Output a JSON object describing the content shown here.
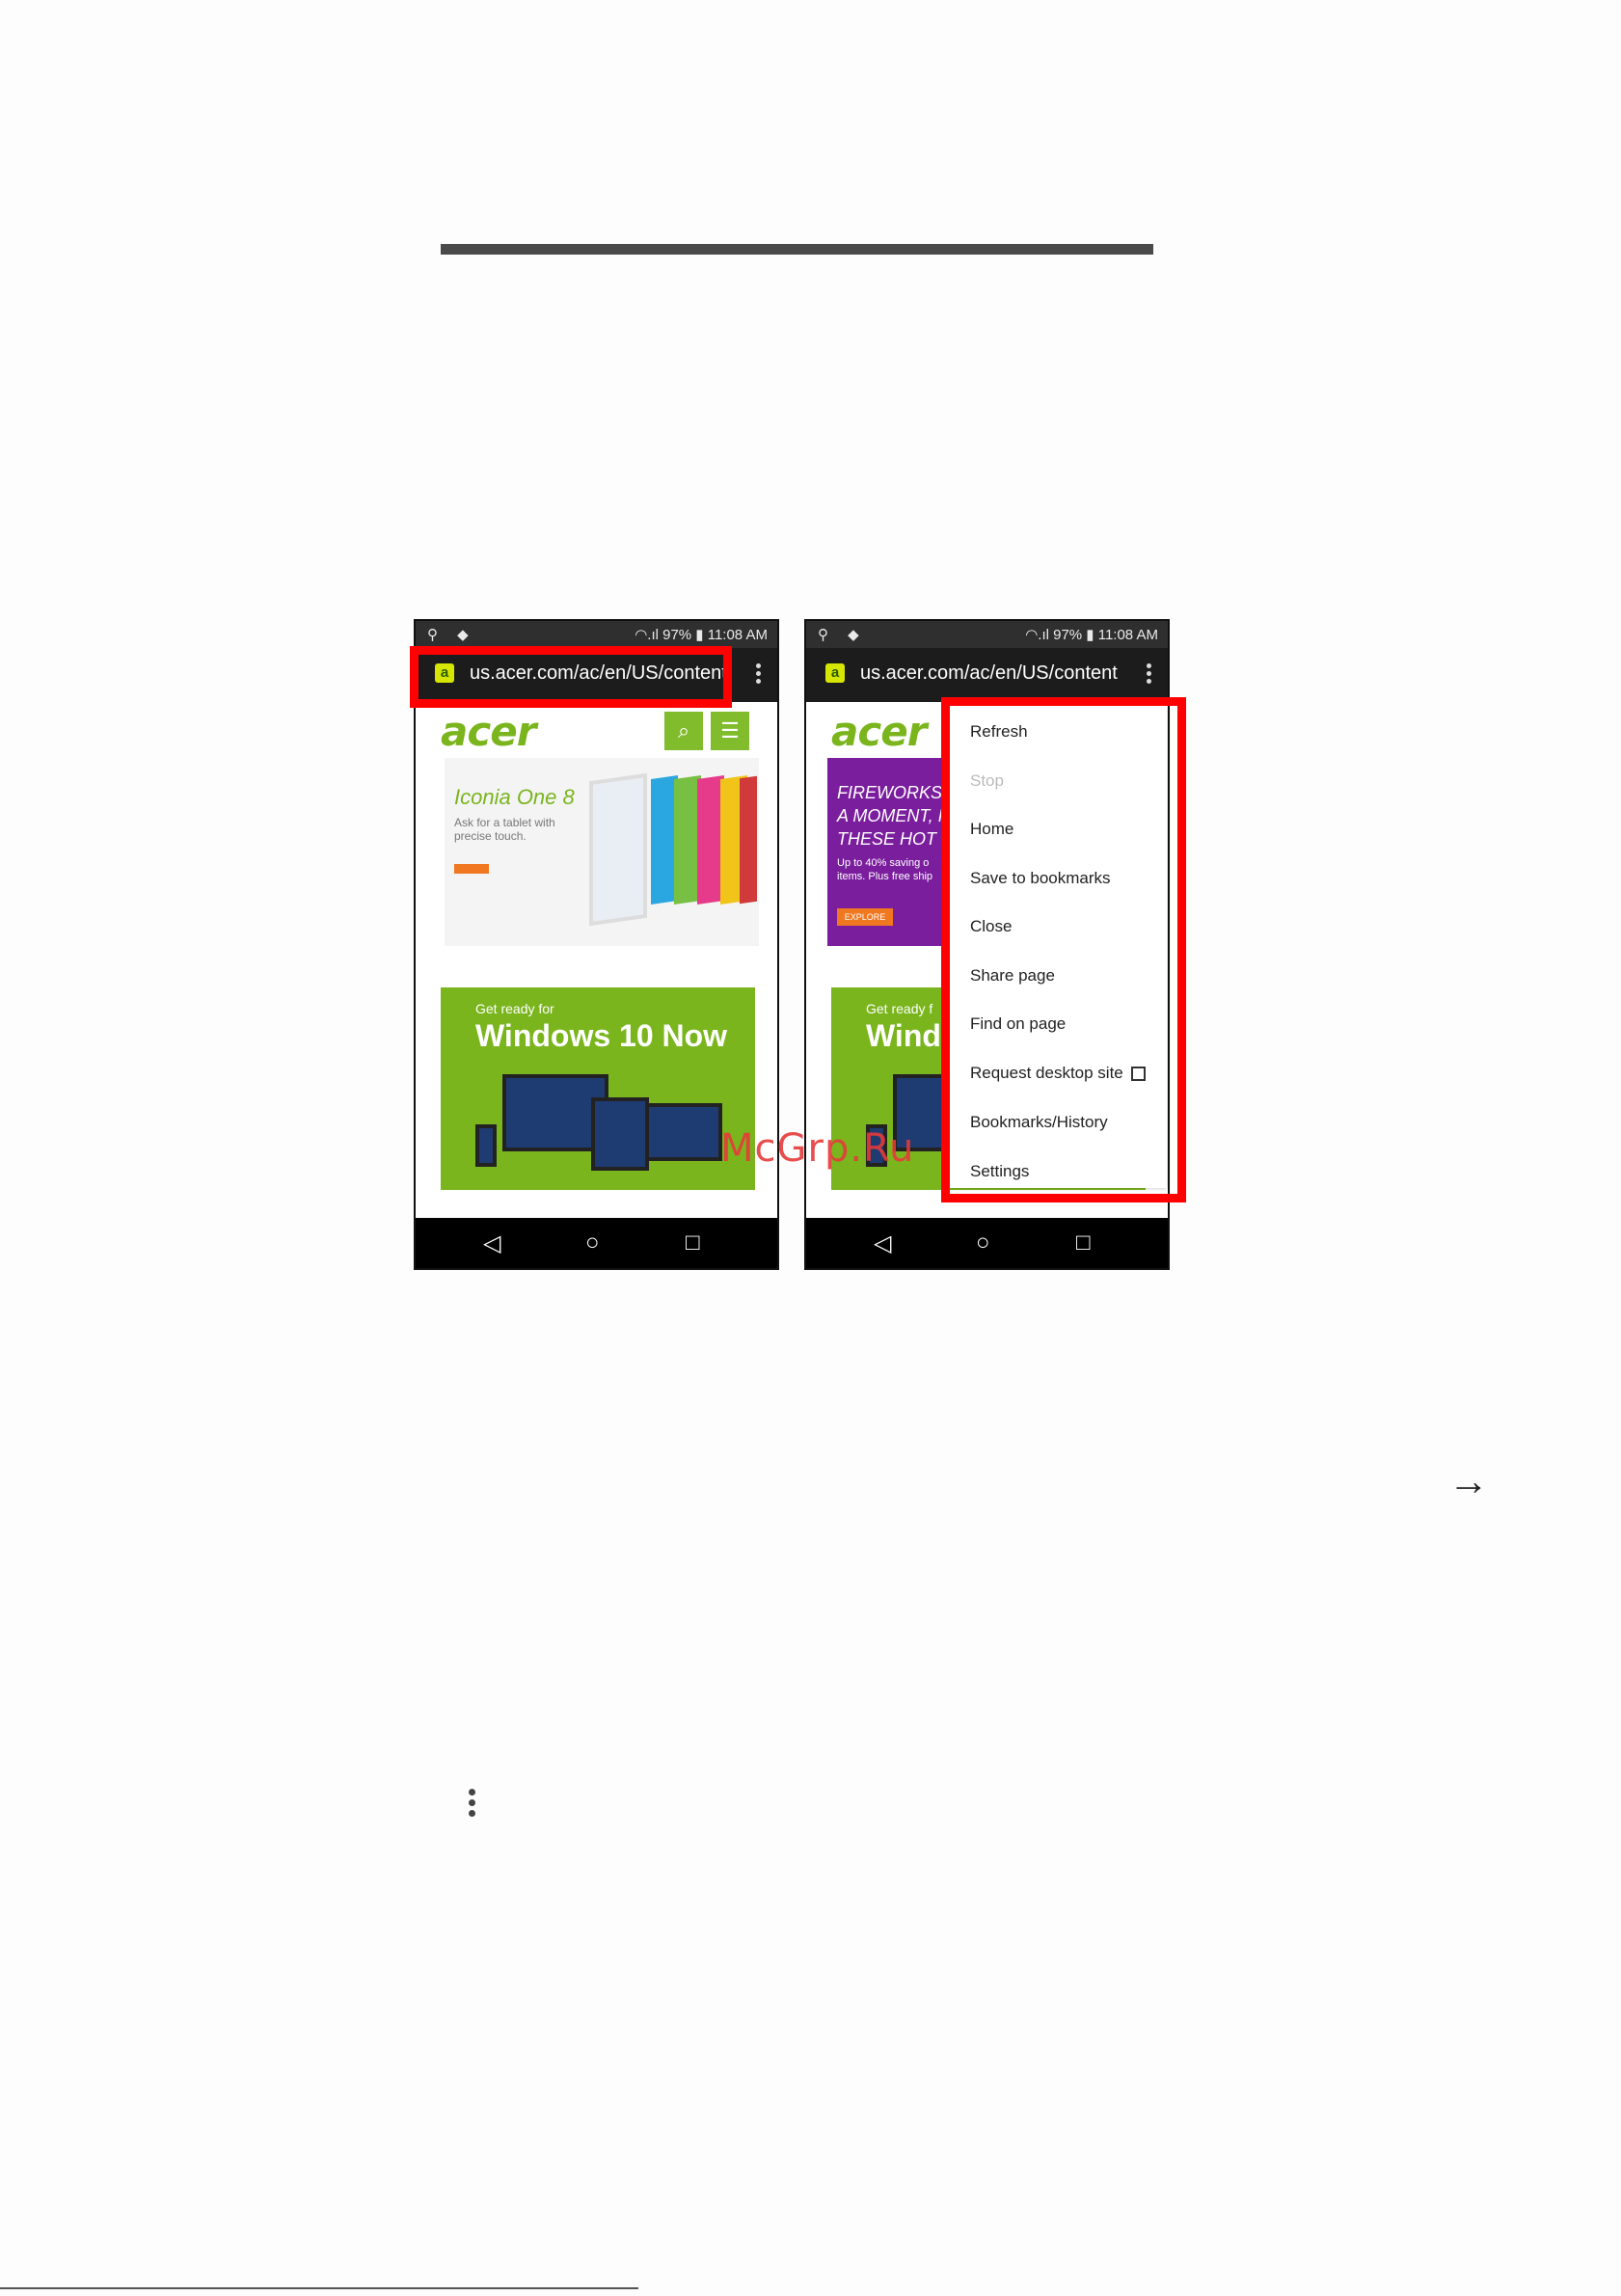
{
  "phone_left": {
    "status_left": "⚲ ◆",
    "status_right": "◠.ıl 97% ▮ 11:08 AM",
    "favicon": "a",
    "url": "us.acer.com/ac/en/US/content",
    "logo": "acer",
    "search_icon": "⌕",
    "menu_icon": "☰",
    "banner1_title": "Iconia One 8",
    "banner1_text": "Ask for a tablet with precise touch.",
    "banner2_small": "Get ready for",
    "banner2_title": "Windows 10 Now"
  },
  "phone_right": {
    "status_left": "⚲ ◆",
    "status_right": "◠.ıl 97% ▮ 11:08 AM",
    "favicon": "a",
    "url": "us.acer.com/ac/en/US/content",
    "logo": "acer",
    "banner3_title": "FIREWORKS O\nA MOMENT, IL\nTHESE HOT D",
    "banner3_text": "Up to 40% saving o\nitems. Plus free ship",
    "banner3_cta": "EXPLORE",
    "banner2_small": "Get ready f",
    "banner2_title": "Wind"
  },
  "menu": {
    "refresh": "Refresh",
    "stop": "Stop",
    "home": "Home",
    "save_bookmarks": "Save to bookmarks",
    "close": "Close",
    "share_page": "Share page",
    "find_on_page": "Find on page",
    "request_desktop": "Request desktop site",
    "bookmarks_history": "Bookmarks/History",
    "settings": "Settings"
  },
  "nav_icons": {
    "back": "◁",
    "home": "○",
    "recent": "□"
  },
  "watermark": "McGrp.Ru",
  "arrow_glyph": "→",
  "accent_colors": {
    "highlight": "#ff0000",
    "acer_green": "#7ab51d"
  }
}
